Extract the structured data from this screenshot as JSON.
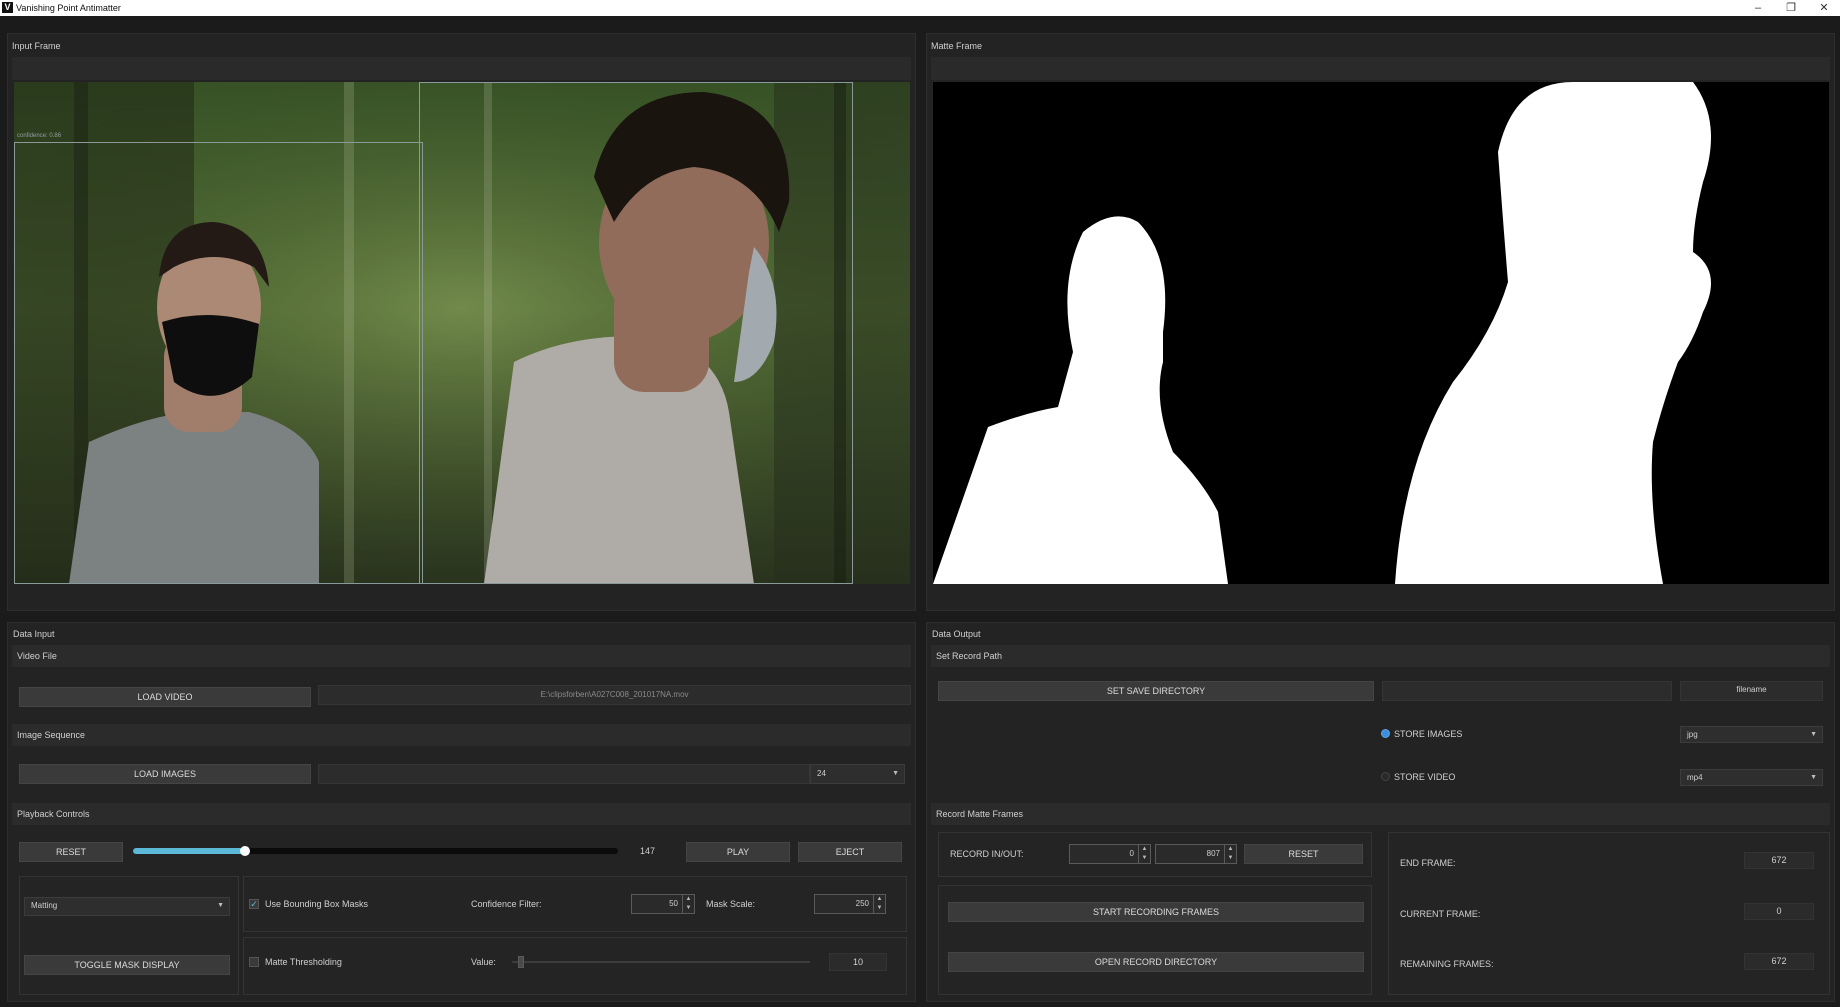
{
  "window": {
    "title": "Vanishing Point Antimatter",
    "logo": "V",
    "min_icon": "–",
    "restore_icon": "❐",
    "close_icon": "✕"
  },
  "input_frame": {
    "title": "Input Frame",
    "box_label": "confidence: 0.86"
  },
  "matte_frame": {
    "title": "Matte Frame"
  },
  "data_input": {
    "title": "Data Input",
    "video_file": {
      "section": "Video File",
      "load_label": "LOAD VIDEO",
      "path": "E:\\clipsforben\\A027C008_201017NA.mov"
    },
    "image_sequence": {
      "section": "Image Sequence",
      "load_label": "LOAD IMAGES",
      "path": "",
      "fps": "24"
    },
    "playback": {
      "section": "Playback Controls",
      "reset_label": "RESET",
      "frame": "147",
      "progress": 0.23,
      "play_label": "PLAY",
      "eject_label": "EJECT"
    },
    "mode": {
      "selected": "Matting",
      "toggle_label": "TOGGLE MASK DISPLAY"
    },
    "bbox": {
      "label": "Use Bounding Box Masks",
      "checked": true,
      "confidence_label": "Confidence Filter:",
      "confidence": "50",
      "mask_scale_label": "Mask Scale:",
      "mask_scale": "250"
    },
    "threshold": {
      "label": "Matte Thresholding",
      "checked": false,
      "value_label": "Value:",
      "value": "10",
      "slider": 0.02
    }
  },
  "data_output": {
    "title": "Data Output",
    "record_path": {
      "section": "Set Record Path",
      "save_dir_label": "SET SAVE DIRECTORY",
      "path": "",
      "filename": "filename",
      "store_images_label": "STORE IMAGES",
      "store_images_selected": true,
      "image_format": "jpg",
      "store_video_label": "STORE VIDEO",
      "store_video_selected": false,
      "video_format": "mp4"
    },
    "record_frames": {
      "section": "Record Matte Frames",
      "in_out_label": "RECORD IN/OUT:",
      "in": "0",
      "out": "807",
      "reset_label": "RESET",
      "start_label": "START RECORDING FRAMES",
      "open_dir_label": "OPEN RECORD DIRECTORY",
      "end_frame_label": "END FRAME:",
      "end_frame": "672",
      "current_frame_label": "CURRENT FRAME:",
      "current_frame": "0",
      "remaining_frames_label": "REMAINING FRAMES:",
      "remaining_frames": "672"
    }
  },
  "colors": {
    "accent": "#5bb8d6",
    "radio_on": "#3d8fdc",
    "background": "#1b1b1b"
  }
}
